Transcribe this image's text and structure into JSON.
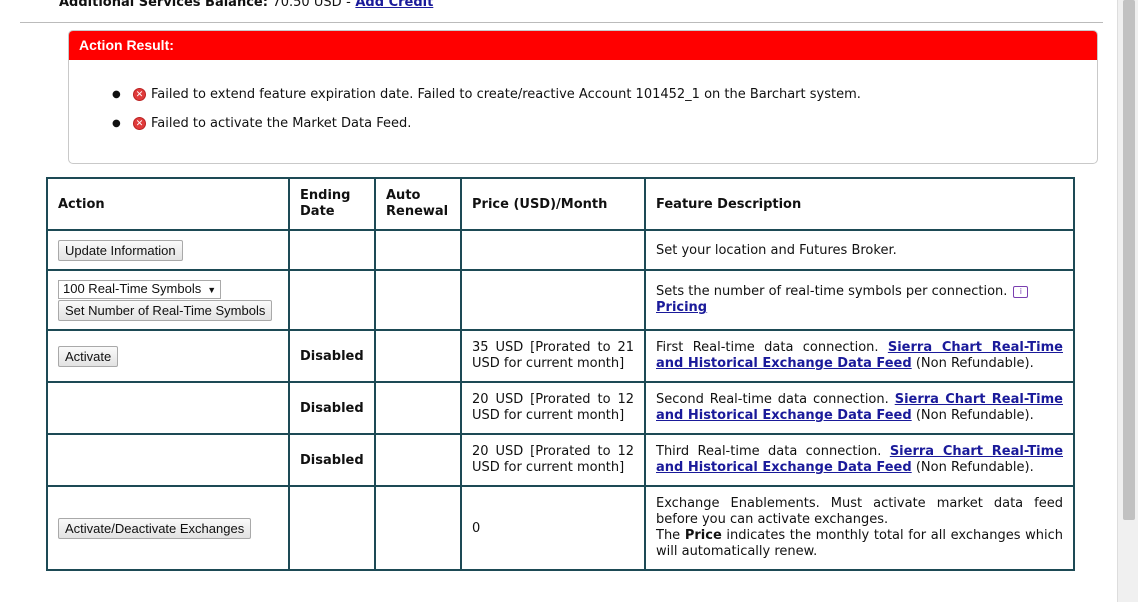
{
  "balance": {
    "label": "Additional Services Balance:",
    "value": "70.50 USD",
    "separator": "-",
    "add_credit": "Add Credit"
  },
  "action_result": {
    "title": "Action Result:",
    "messages": [
      "Failed to extend feature expiration date. Failed to create/reactive Account 101452_1 on the Barchart system.",
      "Failed to activate the Market Data Feed."
    ]
  },
  "table": {
    "headers": {
      "action": "Action",
      "ending_date": "Ending Date",
      "auto_renewal": "Auto Renewal",
      "price": "Price (USD)/Month",
      "description": "Feature Description"
    },
    "rows": [
      {
        "button": "Update Information",
        "ending_date": "",
        "price": "",
        "description": "Set your location and Futures Broker."
      },
      {
        "select_value": "100 Real-Time Symbols",
        "button": "Set Number of Real-Time Symbols",
        "description": "Sets the number of real-time symbols per connection.",
        "link": "Pricing"
      },
      {
        "button": "Activate",
        "ending_date": "Disabled",
        "price": "35 USD [Prorated to 21 USD for current month]",
        "description": "First Real-time data connection.",
        "link": "Sierra Chart Real-Time and Historical Exchange Data Feed",
        "suffix": "(Non Refundable)."
      },
      {
        "ending_date": "Disabled",
        "price": "20 USD [Prorated to 12 USD for current month]",
        "description": "Second Real-time data connection.",
        "link": "Sierra Chart Real-Time and Historical Exchange Data Feed",
        "suffix": "(Non Refundable)."
      },
      {
        "ending_date": "Disabled",
        "price": "20 USD [Prorated to 12 USD for current month]",
        "description": "Third Real-time data connection.",
        "link": "Sierra Chart Real-Time and Historical Exchange Data Feed",
        "suffix": "(Non Refundable)."
      },
      {
        "button": "Activate/Deactivate Exchanges",
        "price": "0",
        "description_1": "Exchange Enablements. Must activate market data feed before you can activate exchanges.",
        "description_2a": "The",
        "description_2b": "Price",
        "description_2c": "indicates the monthly total for all exchanges which will automatically renew."
      }
    ]
  },
  "colors": {
    "result_header": "#ff0000",
    "table_border": "#1d4a55",
    "link": "#1a1a9a"
  },
  "icons": {
    "error": "error-circle-icon",
    "info": "info-icon"
  }
}
